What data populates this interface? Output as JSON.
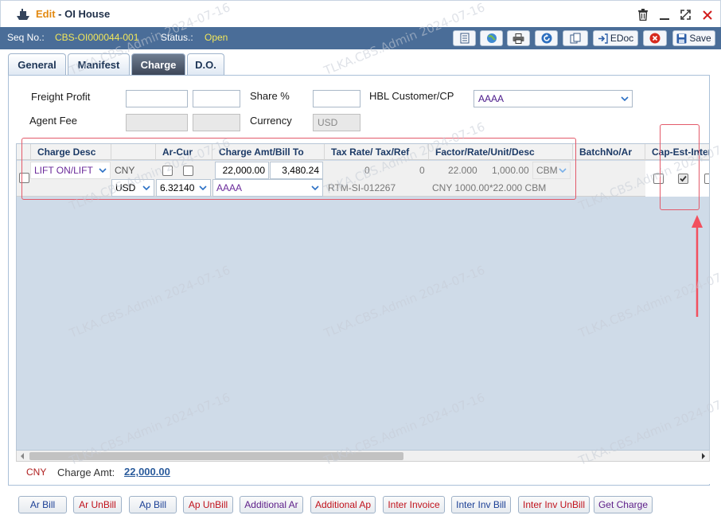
{
  "window": {
    "edit_label": "Edit",
    "title_sep": " - ",
    "title": "OI House"
  },
  "seq": {
    "seq_label": "Seq No.:",
    "seq_value": "CBS-OI000044-001",
    "status_label": "Status.:",
    "status_value": "Open"
  },
  "toolbar": {
    "edoc_label": "EDoc",
    "save_label": "Save"
  },
  "tabs": [
    {
      "label": "General"
    },
    {
      "label": "Manifest"
    },
    {
      "label": "Charge"
    },
    {
      "label": "D.O."
    }
  ],
  "form": {
    "freight_profit_label": "Freight Profit",
    "share_label": "Share %",
    "hbl_customer_label": "HBL Customer/CP",
    "hbl_customer_value": "AAAA",
    "agent_fee_label": "Agent Fee",
    "currency_label": "Currency",
    "currency_value": "USD"
  },
  "grid": {
    "headers": [
      "Charge Desc",
      "Ar-Cur",
      "Charge Amt/Bill To",
      "Tax Rate/ Tax/Ref",
      "Factor/Rate/Unit/Desc",
      "BatchNo/Ar",
      "Cap-Est-Inter"
    ],
    "row": {
      "charge_desc": "LIFT ON/LIFT",
      "cur1": "CNY",
      "cur2": "USD",
      "ex_rate": "6.32140",
      "charge_amt": "22,000.00",
      "bill_amt": "3,480.24",
      "bill_to": "AAAA",
      "tax_rate": "0",
      "tax": "0",
      "ref": "RTM-SI-012267",
      "factor": "22.000",
      "rate": "1,000.00",
      "unit": "CBM",
      "desc": "CNY 1000.00*22.000 CBM"
    }
  },
  "summary": {
    "currency": "CNY",
    "charge_amt_label": "Charge Amt:",
    "charge_amt_value": "22,000.00"
  },
  "bottom_buttons": [
    {
      "label": "Ar Bill"
    },
    {
      "label": "Ar UnBill"
    },
    {
      "label": "Ap Bill"
    },
    {
      "label": "Ap UnBill"
    },
    {
      "label": "Additional Ar"
    },
    {
      "label": "Additional Ap"
    },
    {
      "label": "Inter Invoice"
    },
    {
      "label": "Inter Inv Bill"
    },
    {
      "label": "Inter Inv UnBill"
    },
    {
      "label": "Get Charge"
    }
  ],
  "watermark": "TLKA.CBS.Admin 2024-07-16",
  "colors": {
    "header_bar": "#4a6d98",
    "seq_value": "#f1e65a",
    "annotation": "#e35a6a"
  }
}
